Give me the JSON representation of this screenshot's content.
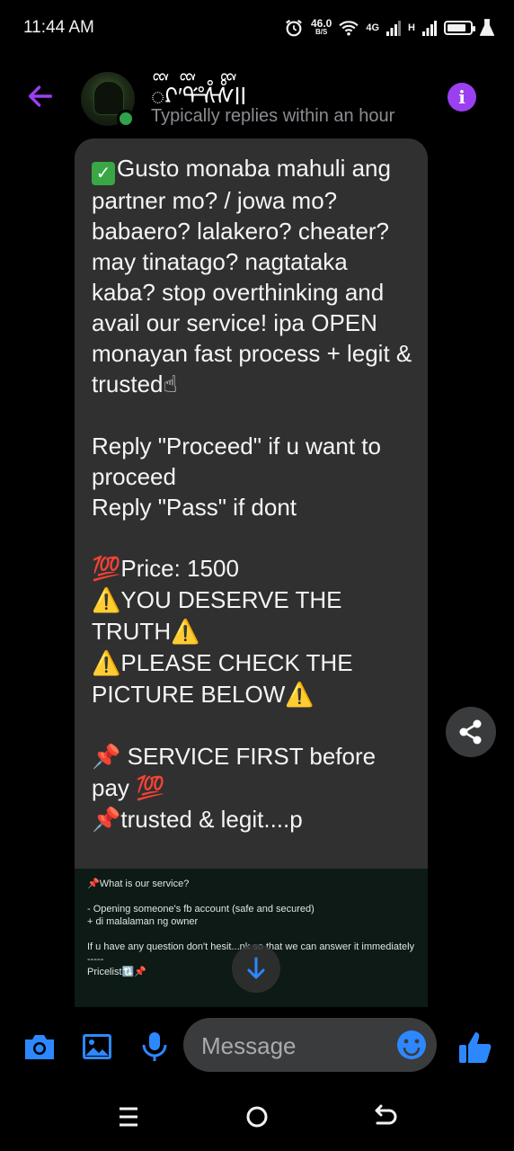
{
  "status_bar": {
    "time": "11:44 AM",
    "speed_value": "46.0",
    "speed_unit": "B/S",
    "network_label": "4G",
    "network_label_2": "H",
    "battery_level": 0.85,
    "icons": [
      "alarm-icon",
      "wifi-icon",
      "signal-icon",
      "battery-icon",
      "flask-icon"
    ]
  },
  "header": {
    "contact_name": "ᢅᡗᢅ′ᢡᢥᢥᢅll",
    "status": "Typically replies within an hour",
    "info_glyph": "i",
    "accent_color": "#9b40f0",
    "online_color": "#31a24c"
  },
  "message": {
    "paragraph_1": "Gusto monaba mahuli ang partner mo? / jowa mo? babaero? lalakero? cheater? may tinatago? nagtataka kaba? stop overthinking and avail our service! ipa OPEN monayan fast process + legit & trusted",
    "line_reply_proceed": "Reply \"Proceed\" if u want to proceed",
    "line_reply_pass": "Reply \"Pass\" if dont",
    "price": "Price: 1500",
    "deserve_truth": "YOU DESERVE THE TRUTH",
    "check_picture": "PLEASE CHECK THE PICTURE BELOW",
    "service_first": " SERVICE FIRST before pay ",
    "trusted_legit": "trusted & legit....p",
    "emojis": {
      "check": "✓",
      "hundred": "💯",
      "warning": "⚠️",
      "pin": "📌",
      "finger": "☝"
    }
  },
  "image_preview": {
    "line_1": "📌What is our service?",
    "line_2": "- Opening someone's fb account (safe and secured)",
    "line_3": "+ di malalaman ng owner",
    "line_4": "If u have any question don't hesit...nk so that we can answer it immediately",
    "line_5": "-----",
    "line_6": "Pricelist🔃📌"
  },
  "composer": {
    "placeholder": "Message",
    "buttons": [
      "camera-icon",
      "gallery-icon",
      "microphone-icon",
      "emoji-icon",
      "thumbs-up-icon"
    ],
    "accent_color": "#2d88ff"
  },
  "nav_bar": {
    "buttons": [
      "recents-icon",
      "home-icon",
      "back-icon"
    ]
  }
}
